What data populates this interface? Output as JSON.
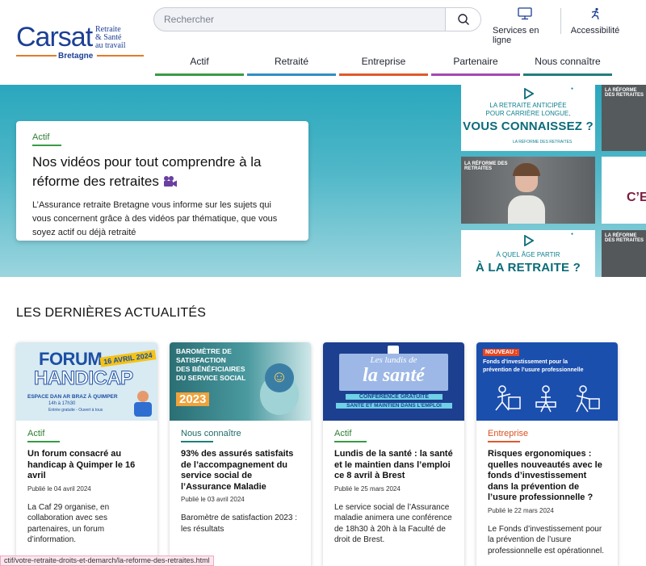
{
  "logo": {
    "word": "Carsat",
    "tag": [
      "Retraite",
      "& Santé",
      "au travail"
    ],
    "region": "Bretagne"
  },
  "search": {
    "placeholder": "Rechercher",
    "icon": "search-icon"
  },
  "utilities": [
    {
      "label": "Services en ligne",
      "icon": "monitor-icon"
    },
    {
      "label": "Accessibilité",
      "icon": "accessibility-icon"
    }
  ],
  "nav": [
    {
      "label": "Actif",
      "color": "#3a9a45"
    },
    {
      "label": "Retraité",
      "color": "#2f8fc4"
    },
    {
      "label": "Entreprise",
      "color": "#e0592a"
    },
    {
      "label": "Partenaire",
      "color": "#a349b0"
    },
    {
      "label": "Nous connaître",
      "color": "#1f7f7a"
    }
  ],
  "hero": {
    "category": "Actif",
    "title": "Nos vidéos pour tout comprendre à la réforme des retraites",
    "description": "L’Assurance retraite Bretagne vous informe sur les sujets qui vous concernent grâce à des vidéos par thématique, que vous soyez actif ou déjà retraité",
    "tile_a": {
      "line1": "LA RETRAITE ANTICIPÉE",
      "line2": "POUR CARRIÈRE LONGUE,",
      "big": "VOUS CONNAISSEZ ?",
      "footer": "LA RÉFORME DES RETRAITES"
    },
    "tile_b": {
      "label": "LA RÉFORME DES RETRAITES"
    },
    "tile_c": {
      "line1": "À QUEL ÂGE PARTIR",
      "big": "À LA RETRAITE ?"
    },
    "tile_d": {
      "label": "LA RÉFORME DES RETRAITES"
    },
    "tile_e": {
      "big": "C’E"
    },
    "tile_f": {
      "label": "LA RÉFORME DES RETRAITES"
    }
  },
  "news": {
    "title": "LES DERNIÈRES ACTUALITÉS",
    "cards": [
      {
        "category": "Actif",
        "color": "#3a9a45",
        "title": "Un forum consacré au handicap à Quimper le 16 avril",
        "date": "Publié le 04 avril 2024",
        "desc": "La Caf 29 organise, en collaboration avec ses partenaires, un forum d’information.",
        "img": {
          "word1": "FORUM",
          "word2": "HANDICAP",
          "badge": "16 AVRIL 2024",
          "place": "ESPACE DAN AR BRAZ À QUIMPER",
          "time": "14h à 17h30",
          "note": "Entrée gratuite - Ouvert à tous"
        }
      },
      {
        "category": "Nous connaître",
        "color": "#1f7f7a",
        "title": "93% des assurés satisfaits de l’accompagnement du service social de l’Assurance Maladie",
        "date": "Publié le 03 avril 2024",
        "desc": "Baromètre de satisfaction 2023 : les résultats",
        "img": {
          "lines": [
            "BAROMÈTRE DE",
            "SATISFACTION",
            "DES BÉNÉFICIAIRES",
            "DU SERVICE SOCIAL"
          ],
          "year": "2023"
        }
      },
      {
        "category": "Actif",
        "color": "#3a9a45",
        "title": "Lundis de la santé : la santé et le maintien dans l’emploi ce 8 avril à Brest",
        "date": "Publié le 25 mars 2024",
        "desc": "Le service social de l’Assurance maladie animera une conférence de 18h30 à 20h à la Faculté de droit de Brest.",
        "img": {
          "top": "Les lundis de",
          "main": "la santé",
          "sub": "CONFÉRENCE GRATUITE",
          "sub2": "SANTÉ ET MAINTIEN DANS L’EMPLOI"
        }
      },
      {
        "category": "Entreprise",
        "color": "#e0592a",
        "title": "Risques ergonomiques : quelles nouveautés avec le fonds d’investissement dans la prévention de l’usure professionnelle ?",
        "date": "Publié le 22 mars 2024",
        "desc": "Le Fonds d’investissement pour la prévention de l’usure professionnelle est opérationnel.",
        "img": {
          "badge": "NOUVEAU :",
          "line1": "Fonds d’investissement pour la",
          "line2": "prévention de l’usure professionnelle"
        }
      }
    ]
  },
  "status_url": "ctif/votre-retraite-droits-et-demarch/la-reforme-des-retraites.html"
}
